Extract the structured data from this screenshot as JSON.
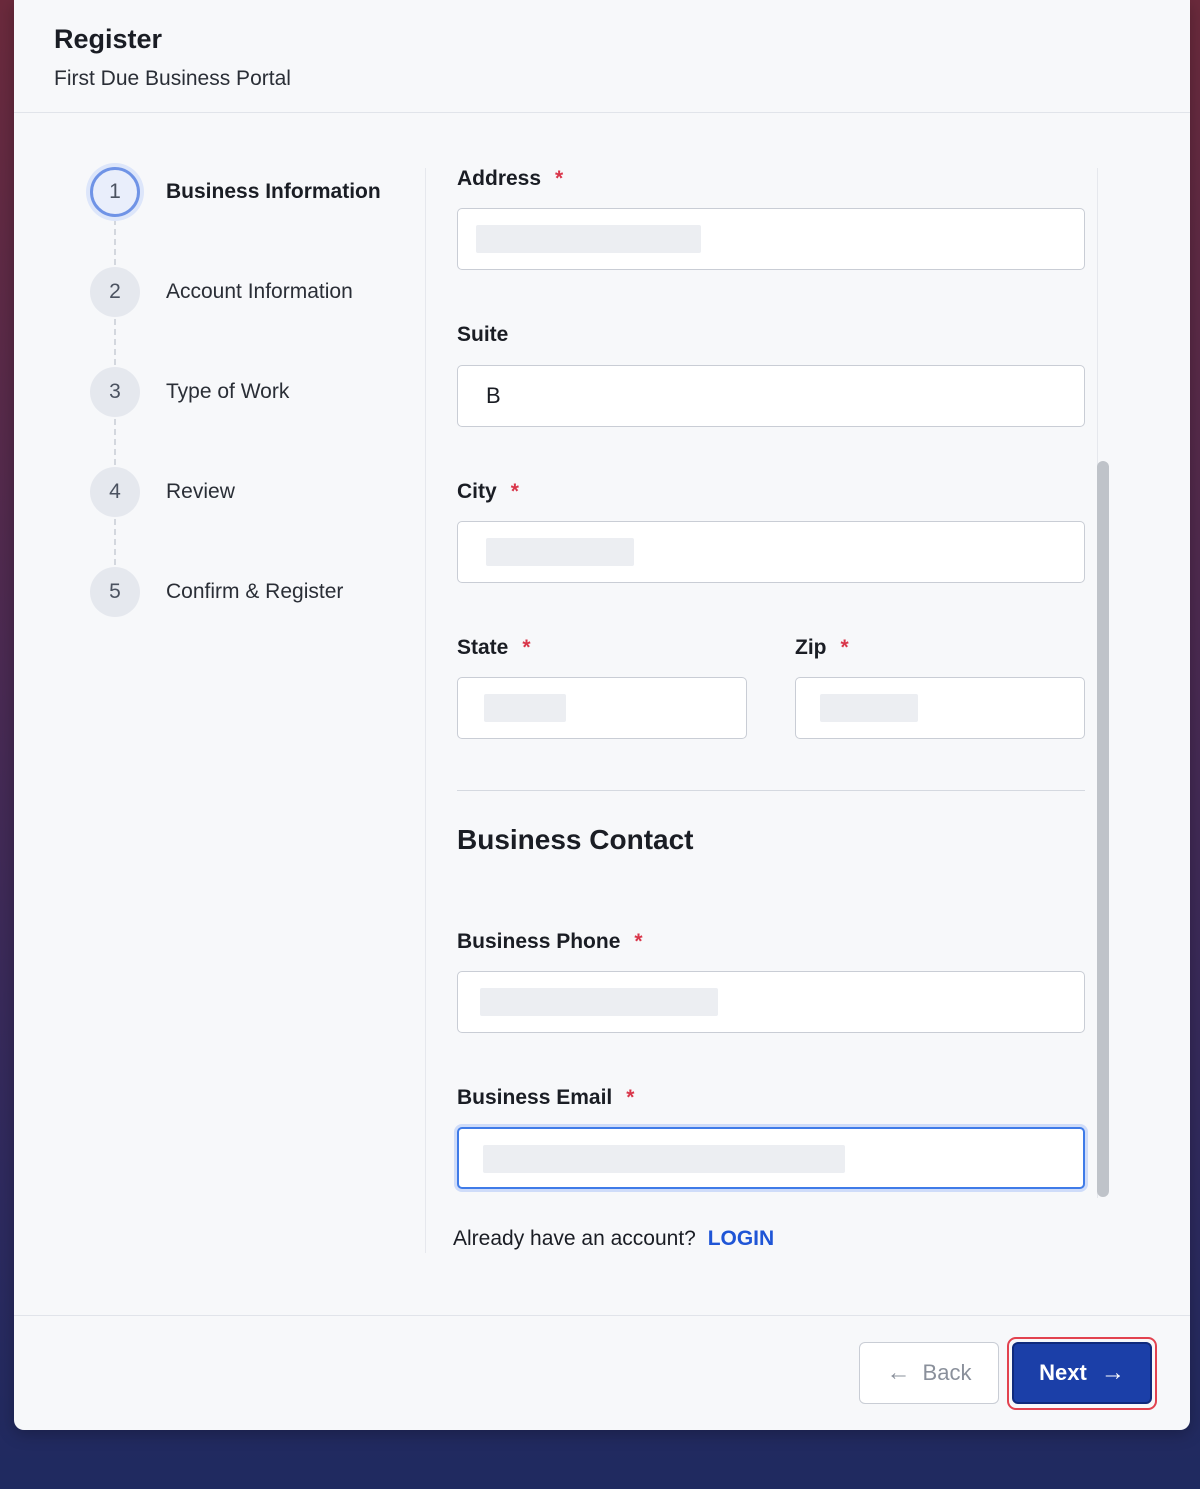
{
  "header": {
    "title": "Register",
    "subtitle": "First Due Business Portal"
  },
  "stepper": {
    "steps": [
      {
        "number": "1",
        "label": "Business Information",
        "active": true
      },
      {
        "number": "2",
        "label": "Account Information",
        "active": false
      },
      {
        "number": "3",
        "label": "Type of Work",
        "active": false
      },
      {
        "number": "4",
        "label": "Review",
        "active": false
      },
      {
        "number": "5",
        "label": "Confirm & Register",
        "active": false
      }
    ]
  },
  "form": {
    "address": {
      "label": "Address",
      "required_mark": "*",
      "value": ""
    },
    "suite": {
      "label": "Suite",
      "value": "B"
    },
    "city": {
      "label": "City",
      "required_mark": "*",
      "value": ""
    },
    "state": {
      "label": "State",
      "required_mark": "*",
      "value": ""
    },
    "zip": {
      "label": "Zip",
      "required_mark": "*",
      "value": ""
    },
    "contact_section_title": "Business Contact",
    "phone": {
      "label": "Business Phone",
      "required_mark": "*",
      "value": ""
    },
    "email": {
      "label": "Business Email",
      "required_mark": "*",
      "value": ""
    }
  },
  "login_prompt": {
    "text": "Already have an account?",
    "link_label": "LOGIN"
  },
  "footer": {
    "back_label": "Back",
    "next_label": "Next",
    "back_icon": "arrow-left-icon",
    "next_icon": "arrow-right-icon"
  },
  "colors": {
    "primary": "#1b3fa8",
    "link": "#1f55d6",
    "required": "#d9364a",
    "highlight_outline": "#e2424f"
  }
}
